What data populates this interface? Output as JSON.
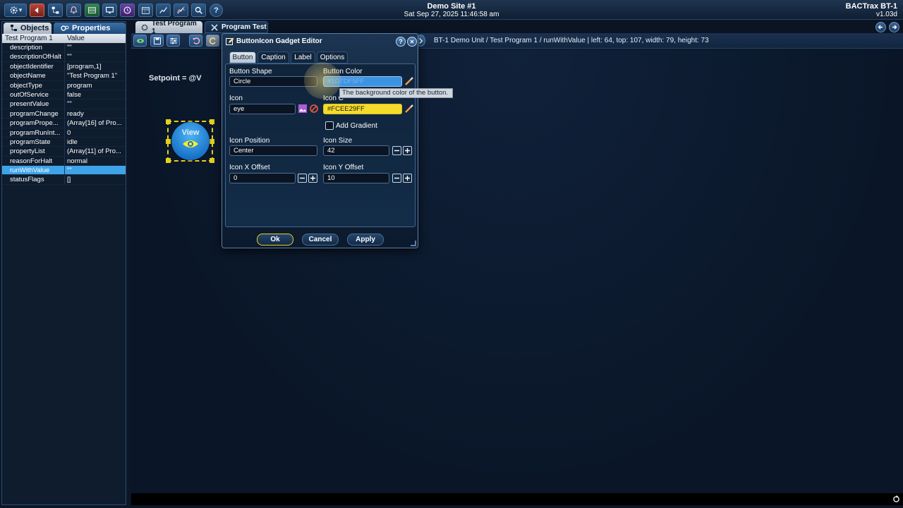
{
  "header": {
    "site_name": "Demo Site #1",
    "datetime": "Sat Sep 27, 2025 11:46:58 am",
    "app_name": "BACTrax BT-1",
    "version": "v1.03d"
  },
  "toolbar": {
    "buttons": [
      "gear-icon",
      "back-icon",
      "network-icon",
      "alarm-icon",
      "table-icon",
      "monitor-icon",
      "schedule-icon",
      "calendar-icon",
      "trend-icon",
      "chart-icon",
      "search-icon",
      "help-icon"
    ],
    "gear_dropdown": "▾",
    "help_label": "?"
  },
  "left_panel": {
    "tabs": {
      "objects": "Objects",
      "properties": "Properties"
    },
    "header": {
      "name": "Test Program 1",
      "value": "Value"
    },
    "rows": [
      {
        "k": "description",
        "v": "\"\""
      },
      {
        "k": "descriptionOfHalt",
        "v": "\"\""
      },
      {
        "k": "objectIdentifier",
        "v": "[program,1]"
      },
      {
        "k": "objectName",
        "v": "\"Test Program 1\""
      },
      {
        "k": "objectType",
        "v": "program"
      },
      {
        "k": "outOfService",
        "v": "false"
      },
      {
        "k": "presentValue",
        "v": "\"\""
      },
      {
        "k": "programChange",
        "v": "ready"
      },
      {
        "k": "programPrope...",
        "v": "(Array[16] of Pro..."
      },
      {
        "k": "programRunInt...",
        "v": "0"
      },
      {
        "k": "programState",
        "v": "idle"
      },
      {
        "k": "propertyList",
        "v": "(Array[11] of Pro..."
      },
      {
        "k": "reasonForHalt",
        "v": "normal"
      },
      {
        "k": "runWithValue",
        "v": "\"\""
      },
      {
        "k": "statusFlags",
        "v": "[]"
      }
    ],
    "selected_index": 13
  },
  "main": {
    "tabs": [
      {
        "label": "Test Program 1"
      },
      {
        "label": "Program Test"
      }
    ],
    "status_text": "BT-1 Demo Unit / Test Program 1 / runWithValue | left: 64, top: 107, width: 79, height: 73",
    "setpoint_text": "Setpoint = @V",
    "view_button_label": "View"
  },
  "dialog": {
    "title": "ButtonIcon Gadget Editor",
    "help": "?",
    "close": "✕",
    "tabs": [
      "Button",
      "Caption",
      "Label",
      "Options"
    ],
    "active_tab": 0,
    "fields": {
      "button_shape_label": "Button Shape",
      "button_shape_value": "Circle",
      "button_color_label": "Button Color",
      "button_color_value": "#1D7DF5FF",
      "icon_label": "Icon",
      "icon_value": "eye",
      "icon_color_label": "Icon C",
      "icon_color_value": "#FCEE29FF",
      "add_gradient_label": "Add Gradient",
      "add_gradient_checked": false,
      "icon_position_label": "Icon Position",
      "icon_position_value": "Center",
      "icon_size_label": "Icon Size",
      "icon_size_value": "42",
      "icon_x_offset_label": "Icon X Offset",
      "icon_x_offset_value": "0",
      "icon_y_offset_label": "Icon Y Offset",
      "icon_y_offset_value": "10"
    },
    "buttons": {
      "ok": "Ok",
      "cancel": "Cancel",
      "apply": "Apply"
    },
    "tooltip": "The background color of the button."
  },
  "colors": {
    "accent": "#3ea3e8",
    "button_color": "#1D7DF5",
    "icon_color": "#FCEE29",
    "selection_yellow": "#e6d11a"
  }
}
